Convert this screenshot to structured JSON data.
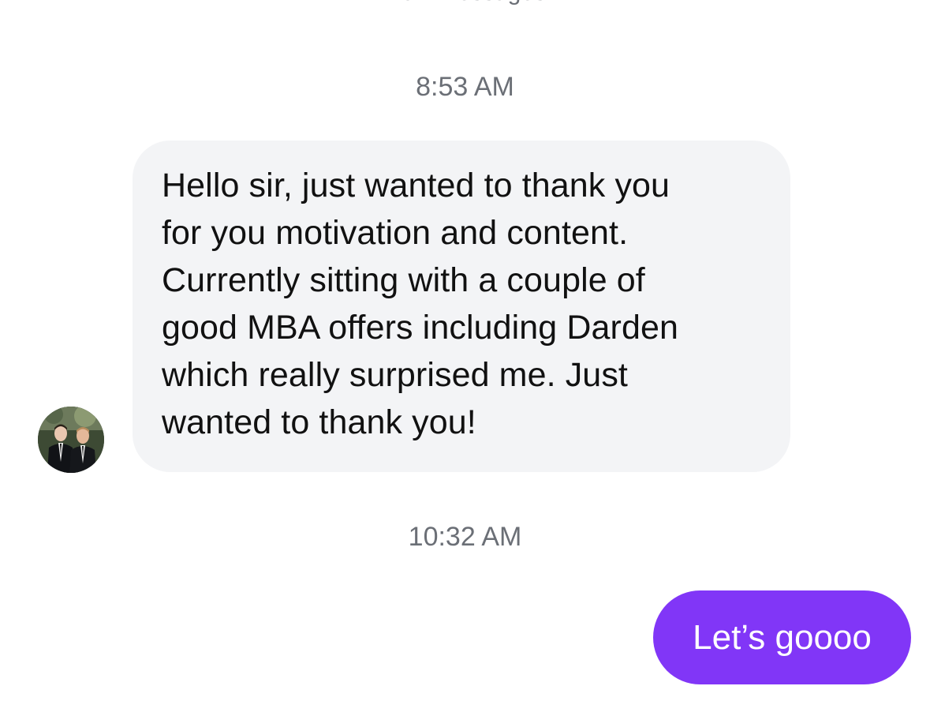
{
  "divider": {
    "label": "New Messages"
  },
  "thread": {
    "timestamps": [
      "8:53 AM",
      "10:32 AM"
    ],
    "incoming_message": {
      "lines": [
        "Hello sir, just wanted to thank you",
        "for you motivation and content.",
        "Currently sitting with a couple of",
        "good MBA offers including Darden",
        "which really surprised me. Just",
        "wanted to thank you!"
      ]
    },
    "outgoing_message": {
      "text": "Let’s goooo"
    }
  },
  "colors": {
    "incoming_bubble": "#f3f4f6",
    "outgoing_bubble": "#8136f7",
    "timestamp_text": "#6b6f76",
    "message_text": "#111111"
  }
}
